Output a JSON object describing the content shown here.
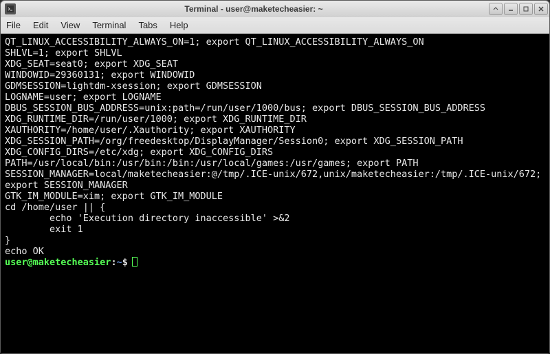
{
  "window": {
    "title": "Terminal - user@maketecheasier: ~"
  },
  "menu": {
    "file": "File",
    "edit": "Edit",
    "view": "View",
    "terminal": "Terminal",
    "tabs": "Tabs",
    "help": "Help"
  },
  "output": {
    "lines": [
      "QT_LINUX_ACCESSIBILITY_ALWAYS_ON=1; export QT_LINUX_ACCESSIBILITY_ALWAYS_ON",
      "SHLVL=1; export SHLVL",
      "XDG_SEAT=seat0; export XDG_SEAT",
      "WINDOWID=29360131; export WINDOWID",
      "GDMSESSION=lightdm-xsession; export GDMSESSION",
      "LOGNAME=user; export LOGNAME",
      "DBUS_SESSION_BUS_ADDRESS=unix:path=/run/user/1000/bus; export DBUS_SESSION_BUS_ADDRESS",
      "XDG_RUNTIME_DIR=/run/user/1000; export XDG_RUNTIME_DIR",
      "XAUTHORITY=/home/user/.Xauthority; export XAUTHORITY",
      "XDG_SESSION_PATH=/org/freedesktop/DisplayManager/Session0; export XDG_SESSION_PATH",
      "XDG_CONFIG_DIRS=/etc/xdg; export XDG_CONFIG_DIRS",
      "PATH=/usr/local/bin:/usr/bin:/bin:/usr/local/games:/usr/games; export PATH",
      "SESSION_MANAGER=local/maketecheasier:@/tmp/.ICE-unix/672,unix/maketecheasier:/tmp/.ICE-unix/672; export SESSION_MANAGER",
      "GTK_IM_MODULE=xim; export GTK_IM_MODULE",
      "cd /home/user || {",
      "        echo 'Execution directory inaccessible' >&2",
      "        exit 1",
      "}",
      "echo OK"
    ]
  },
  "prompt": {
    "user_host": "user@maketecheasier",
    "colon": ":",
    "path": "~",
    "sigil": "$"
  }
}
